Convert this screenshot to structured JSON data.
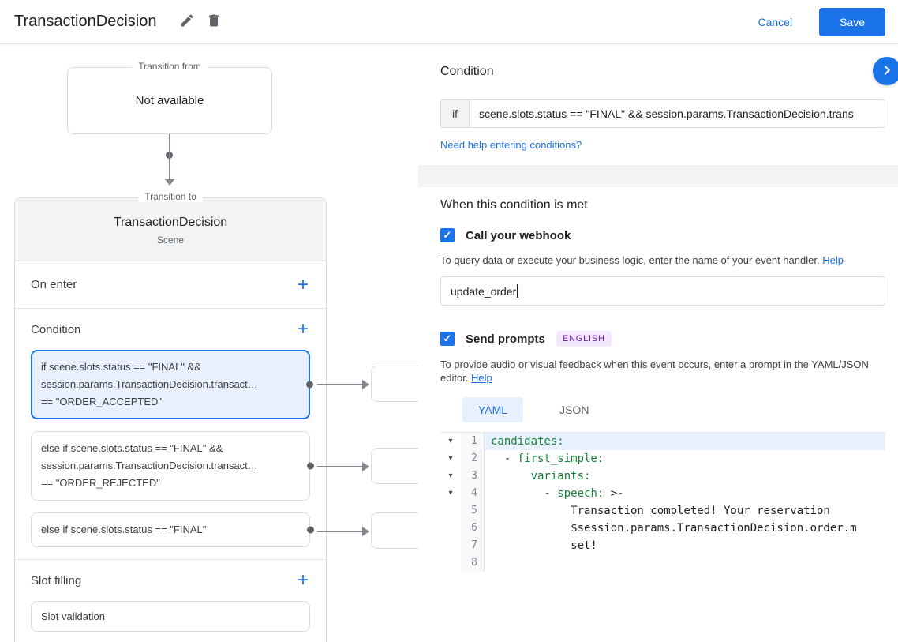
{
  "colors": {
    "accent": "#1a73e8",
    "selected_bg": "#e8f0fe",
    "yaml_key_green": "#188038",
    "badge_bg": "#f3e8fd"
  },
  "icons": {
    "edit": "pencil-icon",
    "delete": "trash-icon",
    "panel_toggle": "chevron-right-icon",
    "arrow": "arrow-head-icon",
    "checkbox_glyph": "✓",
    "add_glyph": "+",
    "fold_glyph": "▾"
  },
  "header": {
    "title": "TransactionDecision",
    "cancel_label": "Cancel",
    "save_label": "Save"
  },
  "diagram": {
    "transition_from": {
      "label": "Transition from",
      "value": "Not available"
    },
    "transition_to": {
      "label": "Transition to",
      "title": "TransactionDecision",
      "subtitle": "Scene",
      "on_enter": {
        "label": "On enter"
      },
      "condition": {
        "label": "Condition",
        "items": [
          {
            "selected": true,
            "lines": [
              "if scene.slots.status == \"FINAL\" &&",
              "session.params.TransactionDecision.transact…",
              "== \"ORDER_ACCEPTED\""
            ]
          },
          {
            "selected": false,
            "lines": [
              "else if scene.slots.status == \"FINAL\" &&",
              "session.params.TransactionDecision.transact…",
              "== \"ORDER_REJECTED\""
            ]
          },
          {
            "selected": false,
            "lines": [
              "else if scene.slots.status == \"FINAL\""
            ]
          }
        ]
      },
      "slot_filling": {
        "label": "Slot filling",
        "items": [
          "Slot validation"
        ]
      }
    }
  },
  "panel": {
    "title": "Condition",
    "condition_row": {
      "prefix": "if",
      "value": "scene.slots.status == \"FINAL\" && session.params.TransactionDecision.trans"
    },
    "conditions_help_link": "Need help entering conditions?",
    "when_met": {
      "title": "When this condition is met",
      "webhook": {
        "label": "Call your webhook",
        "checked": true,
        "description": "To query data or execute your business logic, enter the name of your event handler.",
        "help_label": "Help",
        "input_value": "update_order"
      },
      "prompts": {
        "label": "Send prompts",
        "checked": true,
        "badge": "ENGLISH",
        "description": "To provide audio or visual feedback when this event occurs, enter a prompt in the YAML/JSON editor.",
        "help_label": "Help",
        "tabs": [
          {
            "label": "YAML",
            "active": true
          },
          {
            "label": "JSON",
            "active": false
          }
        ]
      }
    },
    "editor": {
      "lines": [
        {
          "n": "1",
          "fold": true,
          "hl": true,
          "parts": [
            {
              "t": "candidates:",
              "c": "key"
            }
          ]
        },
        {
          "n": "2",
          "fold": true,
          "parts": [
            {
              "t": "  - ",
              "c": "plain"
            },
            {
              "t": "first_simple:",
              "c": "key"
            }
          ]
        },
        {
          "n": "3",
          "fold": true,
          "parts": [
            {
              "t": "      ",
              "c": "plain"
            },
            {
              "t": "variants:",
              "c": "key"
            }
          ]
        },
        {
          "n": "4",
          "fold": true,
          "parts": [
            {
              "t": "        - ",
              "c": "plain"
            },
            {
              "t": "speech:",
              "c": "key"
            },
            {
              "t": " >-",
              "c": "plain"
            }
          ]
        },
        {
          "n": "5",
          "parts": [
            {
              "t": "            Transaction completed! Your reservation",
              "c": "plain"
            }
          ]
        },
        {
          "n": "6",
          "parts": [
            {
              "t": "            $session.params.TransactionDecision.order.m",
              "c": "plain"
            }
          ]
        },
        {
          "n": "7",
          "parts": [
            {
              "t": "            set!",
              "c": "plain"
            }
          ]
        },
        {
          "n": "8",
          "parts": []
        }
      ]
    }
  }
}
